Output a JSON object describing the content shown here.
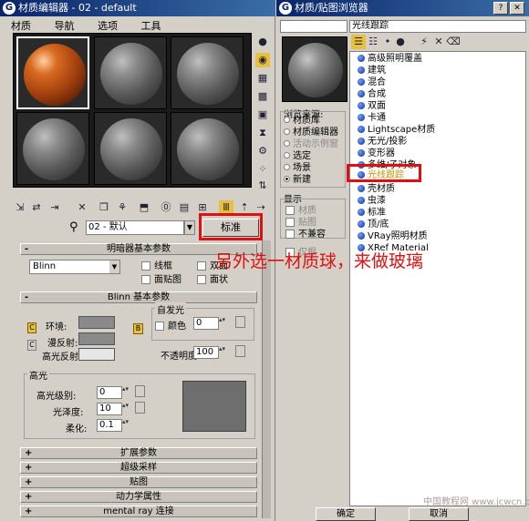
{
  "material_editor": {
    "title": "材质编辑器 - 02 - default",
    "menu": [
      "材质",
      "导航",
      "选项",
      "工具"
    ],
    "slot_name": "02 - 默认",
    "type_button": "标准",
    "basic_params_rollout": "明暗器基本参数",
    "shader": "Blinn",
    "checkboxes": [
      "线框",
      "双面",
      "面贴图",
      "面状"
    ],
    "blinn_rollout": "Blinn 基本参数",
    "self_illum_label": "自发光",
    "color_label": "颜色",
    "self_illum_value": "0",
    "ambient_label": "环境:",
    "diffuse_label": "漫反射:",
    "specular_label": "高光反射:",
    "opacity_label": "不透明度:",
    "opacity_value": "100",
    "highlight_group": "高光",
    "spec_level_label": "高光级别:",
    "spec_level_value": "0",
    "gloss_label": "光泽度:",
    "gloss_value": "10",
    "soften_label": "柔化:",
    "soften_value": "0.1",
    "bottom_rollouts": [
      "扩展参数",
      "超级采样",
      "贴图",
      "动力学属性",
      "mental ray 连接"
    ]
  },
  "browser": {
    "title": "材质/贴图浏览器",
    "filter_value": "光线跟踪",
    "browse_from_label": "浏览来源:",
    "browse_from": [
      "材质库",
      "材质编辑器",
      "活动示例窗",
      "选定",
      "场景",
      "新建"
    ],
    "show_label": "显示",
    "show_options": [
      "材质",
      "贴图",
      "不兼容"
    ],
    "root_label": "仅根",
    "list": [
      "高级照明覆盖",
      "建筑",
      "混合",
      "合成",
      "双面",
      "卡通",
      "Lightscape材质",
      "无光/投影",
      "变形器",
      "多维/子对象",
      "光线跟踪",
      "壳材质",
      "虫漆",
      "标准",
      "顶/底",
      "VRay照明材质",
      "XRef Material"
    ],
    "ok_button": "确定",
    "cancel_button": "取消"
  },
  "annotation": "另外选一材质球，来做玻璃",
  "watermark": "中国教程网  www.jcwcn.com"
}
